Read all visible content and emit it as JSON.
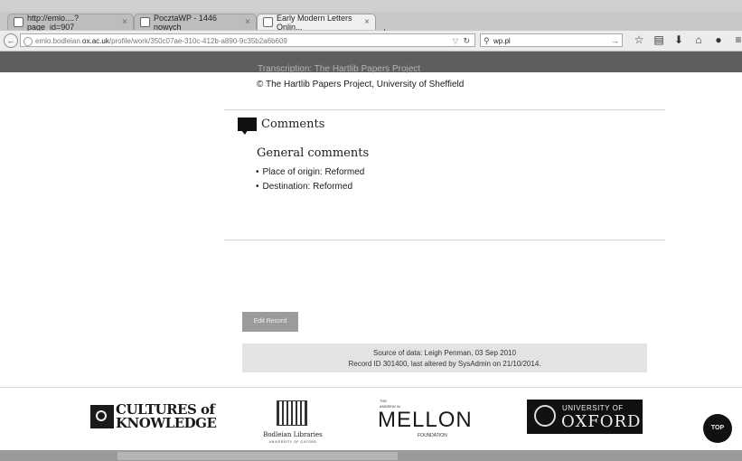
{
  "tabs": [
    {
      "label": "http://emlo....?page_id=907",
      "active": false
    },
    {
      "label": "PocztaWP - 1446 nowych",
      "active": false
    },
    {
      "label": "Early Modern Letters Onlin...",
      "active": true
    }
  ],
  "new_tab_label": "+",
  "nav": {
    "url_domain_prefix": "emlo.bodleian.",
    "url_domain_bold": "ox.ac.uk",
    "url_path": "/profile/work/350c07ae-310c-412b-a890-9c35b2a6b609",
    "search_value": "wp.pl"
  },
  "page": {
    "faded_line": "Transcription: The Hartlib Papers Project",
    "copyright": "© The Hartlib Papers Project, University of Sheffield",
    "comments_heading": "Comments",
    "general_heading": "General comments",
    "comments": [
      "Place of origin: Reformed",
      "Destination: Reformed"
    ],
    "edit_button": "Edit Record",
    "source_line1": "Source of data: Leigh Penman, 03 Sep 2010",
    "source_line2": "Record ID 301400, last altered by SysAdmin on 21/10/2014."
  },
  "footer": {
    "cultures_line1": "CULTURES of",
    "cultures_line2": "KNOWLEDGE",
    "bodleian_name": "Bodleian Libraries",
    "bodleian_sub": "UNIVERSITY OF OXFORD",
    "mellon_the": "THE",
    "mellon_andrew": "ANDREW W.",
    "mellon_word": "MELLON",
    "mellon_foundation": "FOUNDATION",
    "oxford_univ": "UNIVERSITY OF",
    "oxford_word": "OXFORD",
    "top_button": "TOP"
  },
  "icons": [
    "back-arrow-icon",
    "lock-icon",
    "reload-icon",
    "search-icon",
    "star-icon",
    "bookmarks-icon",
    "download-icon",
    "home-icon",
    "chat-icon",
    "menu-icon",
    "comment-icon"
  ]
}
